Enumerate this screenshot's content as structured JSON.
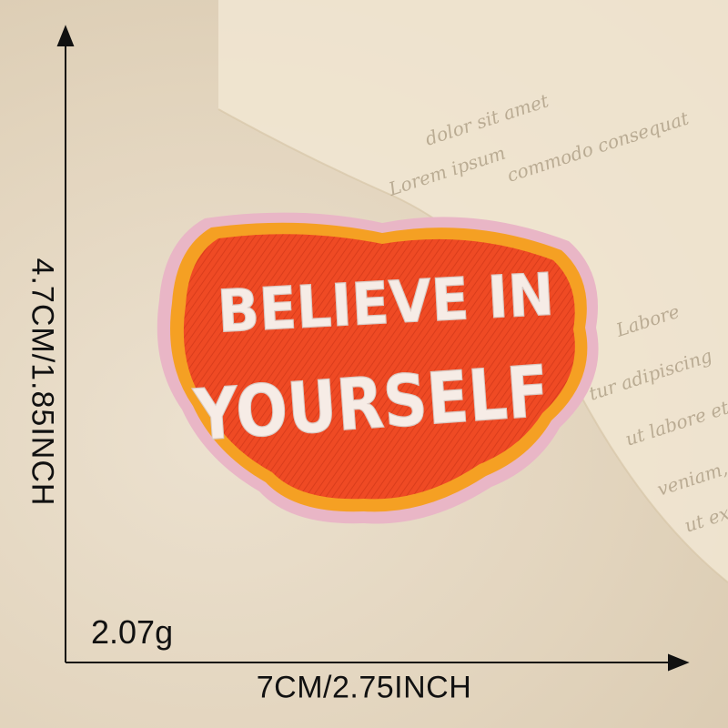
{
  "product": {
    "patch_text_line1": "BELIEVE IN",
    "patch_text_line2": "YOURSELF"
  },
  "dimensions": {
    "height_label": "4.7CM/1.85INCH",
    "width_label": "7CM/2.75INCH",
    "weight_label": "2.07g"
  },
  "background_script": [
    "Lorem ipsum",
    "dolor sit amet",
    "commodo consequat",
    "tur adipiscing",
    "ut labore et",
    "veniam,",
    "ut ex",
    "Labore"
  ],
  "colors": {
    "patch_red": "#ef4a24",
    "patch_orange": "#f5a023",
    "patch_pink": "#e8b9c6",
    "thread_white": "#f6ece6",
    "background": "#e6dac4"
  }
}
